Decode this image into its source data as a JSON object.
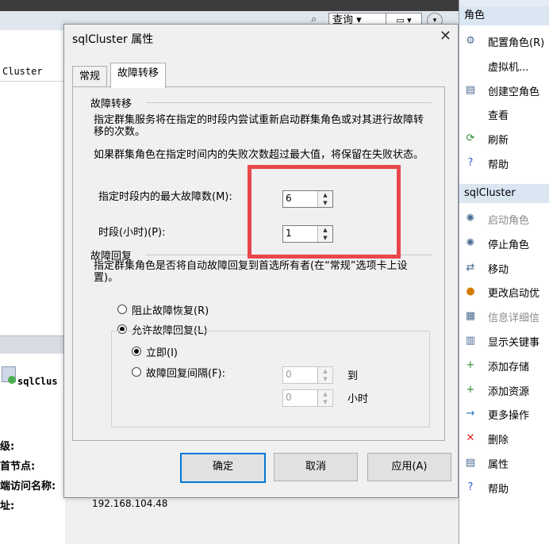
{
  "background": {
    "toolbar_query": "查询",
    "column_header": "Cluster",
    "summary_item": "sqlClus",
    "labels": [
      "级:",
      "首节点:",
      "端访问名称:",
      "址:"
    ],
    "ip_value": "192.168.104.48"
  },
  "dialog": {
    "title": "sqlCluster 属性",
    "tabs": [
      {
        "label": "常规"
      },
      {
        "label": "故障转移"
      }
    ],
    "failover_group": "故障转移",
    "failover_desc1": "指定群集服务将在指定的时段内尝试重新启动群集角色或对其进行故障转移的次数。",
    "failover_desc2": "如果群集角色在指定时间内的失败次数超过最大值，将保留在失败状态。",
    "max_failures_label": "指定时段内的最大故障数(M):",
    "max_failures_value": "6",
    "period_label": "时段(小时)(P):",
    "period_value": "1",
    "failback_group": "故障回复",
    "failback_desc": "指定群集角色是否将自动故障回复到首选所有者(在“常规”选项卡上设置)。",
    "prevent_failback": "阻止故障恢复(R)",
    "allow_failback": "允许故障回复(L)",
    "immediately": "立即(I)",
    "failback_between": "故障回复间隔(F):",
    "from_value": "0",
    "to_label": "到",
    "to_value": "0",
    "hours_label": "小时",
    "ok": "确定",
    "cancel": "取消",
    "apply": "应用(A)"
  },
  "actions": {
    "header1": "角色",
    "items1": [
      {
        "label": "配置角色(R)",
        "icon": "configure-role-icon"
      },
      {
        "label": "虚拟机...",
        "icon": ""
      },
      {
        "label": "创建空角色",
        "icon": "create-empty-role-icon"
      },
      {
        "label": "查看",
        "icon": ""
      },
      {
        "label": "刷新",
        "icon": "refresh-icon"
      },
      {
        "label": "帮助",
        "icon": "help-icon"
      }
    ],
    "header2": "sqlCluster",
    "items2": [
      {
        "label": "启动角色",
        "icon": "start-role-icon",
        "disabled": true
      },
      {
        "label": "停止角色",
        "icon": "stop-role-icon"
      },
      {
        "label": "移动",
        "icon": "move-icon"
      },
      {
        "label": "更改启动优",
        "icon": "change-priority-icon"
      },
      {
        "label": "信息详细信",
        "icon": "info-details-icon",
        "disabled": true
      },
      {
        "label": "显示关键事",
        "icon": "critical-events-icon"
      },
      {
        "label": "添加存储",
        "icon": "add-storage-icon"
      },
      {
        "label": "添加资源",
        "icon": "add-resource-icon"
      },
      {
        "label": "更多操作",
        "icon": "more-actions-icon"
      },
      {
        "label": "删除",
        "icon": "delete-icon"
      },
      {
        "label": "属性",
        "icon": "properties-icon"
      },
      {
        "label": "帮助",
        "icon": "help-icon"
      }
    ]
  }
}
